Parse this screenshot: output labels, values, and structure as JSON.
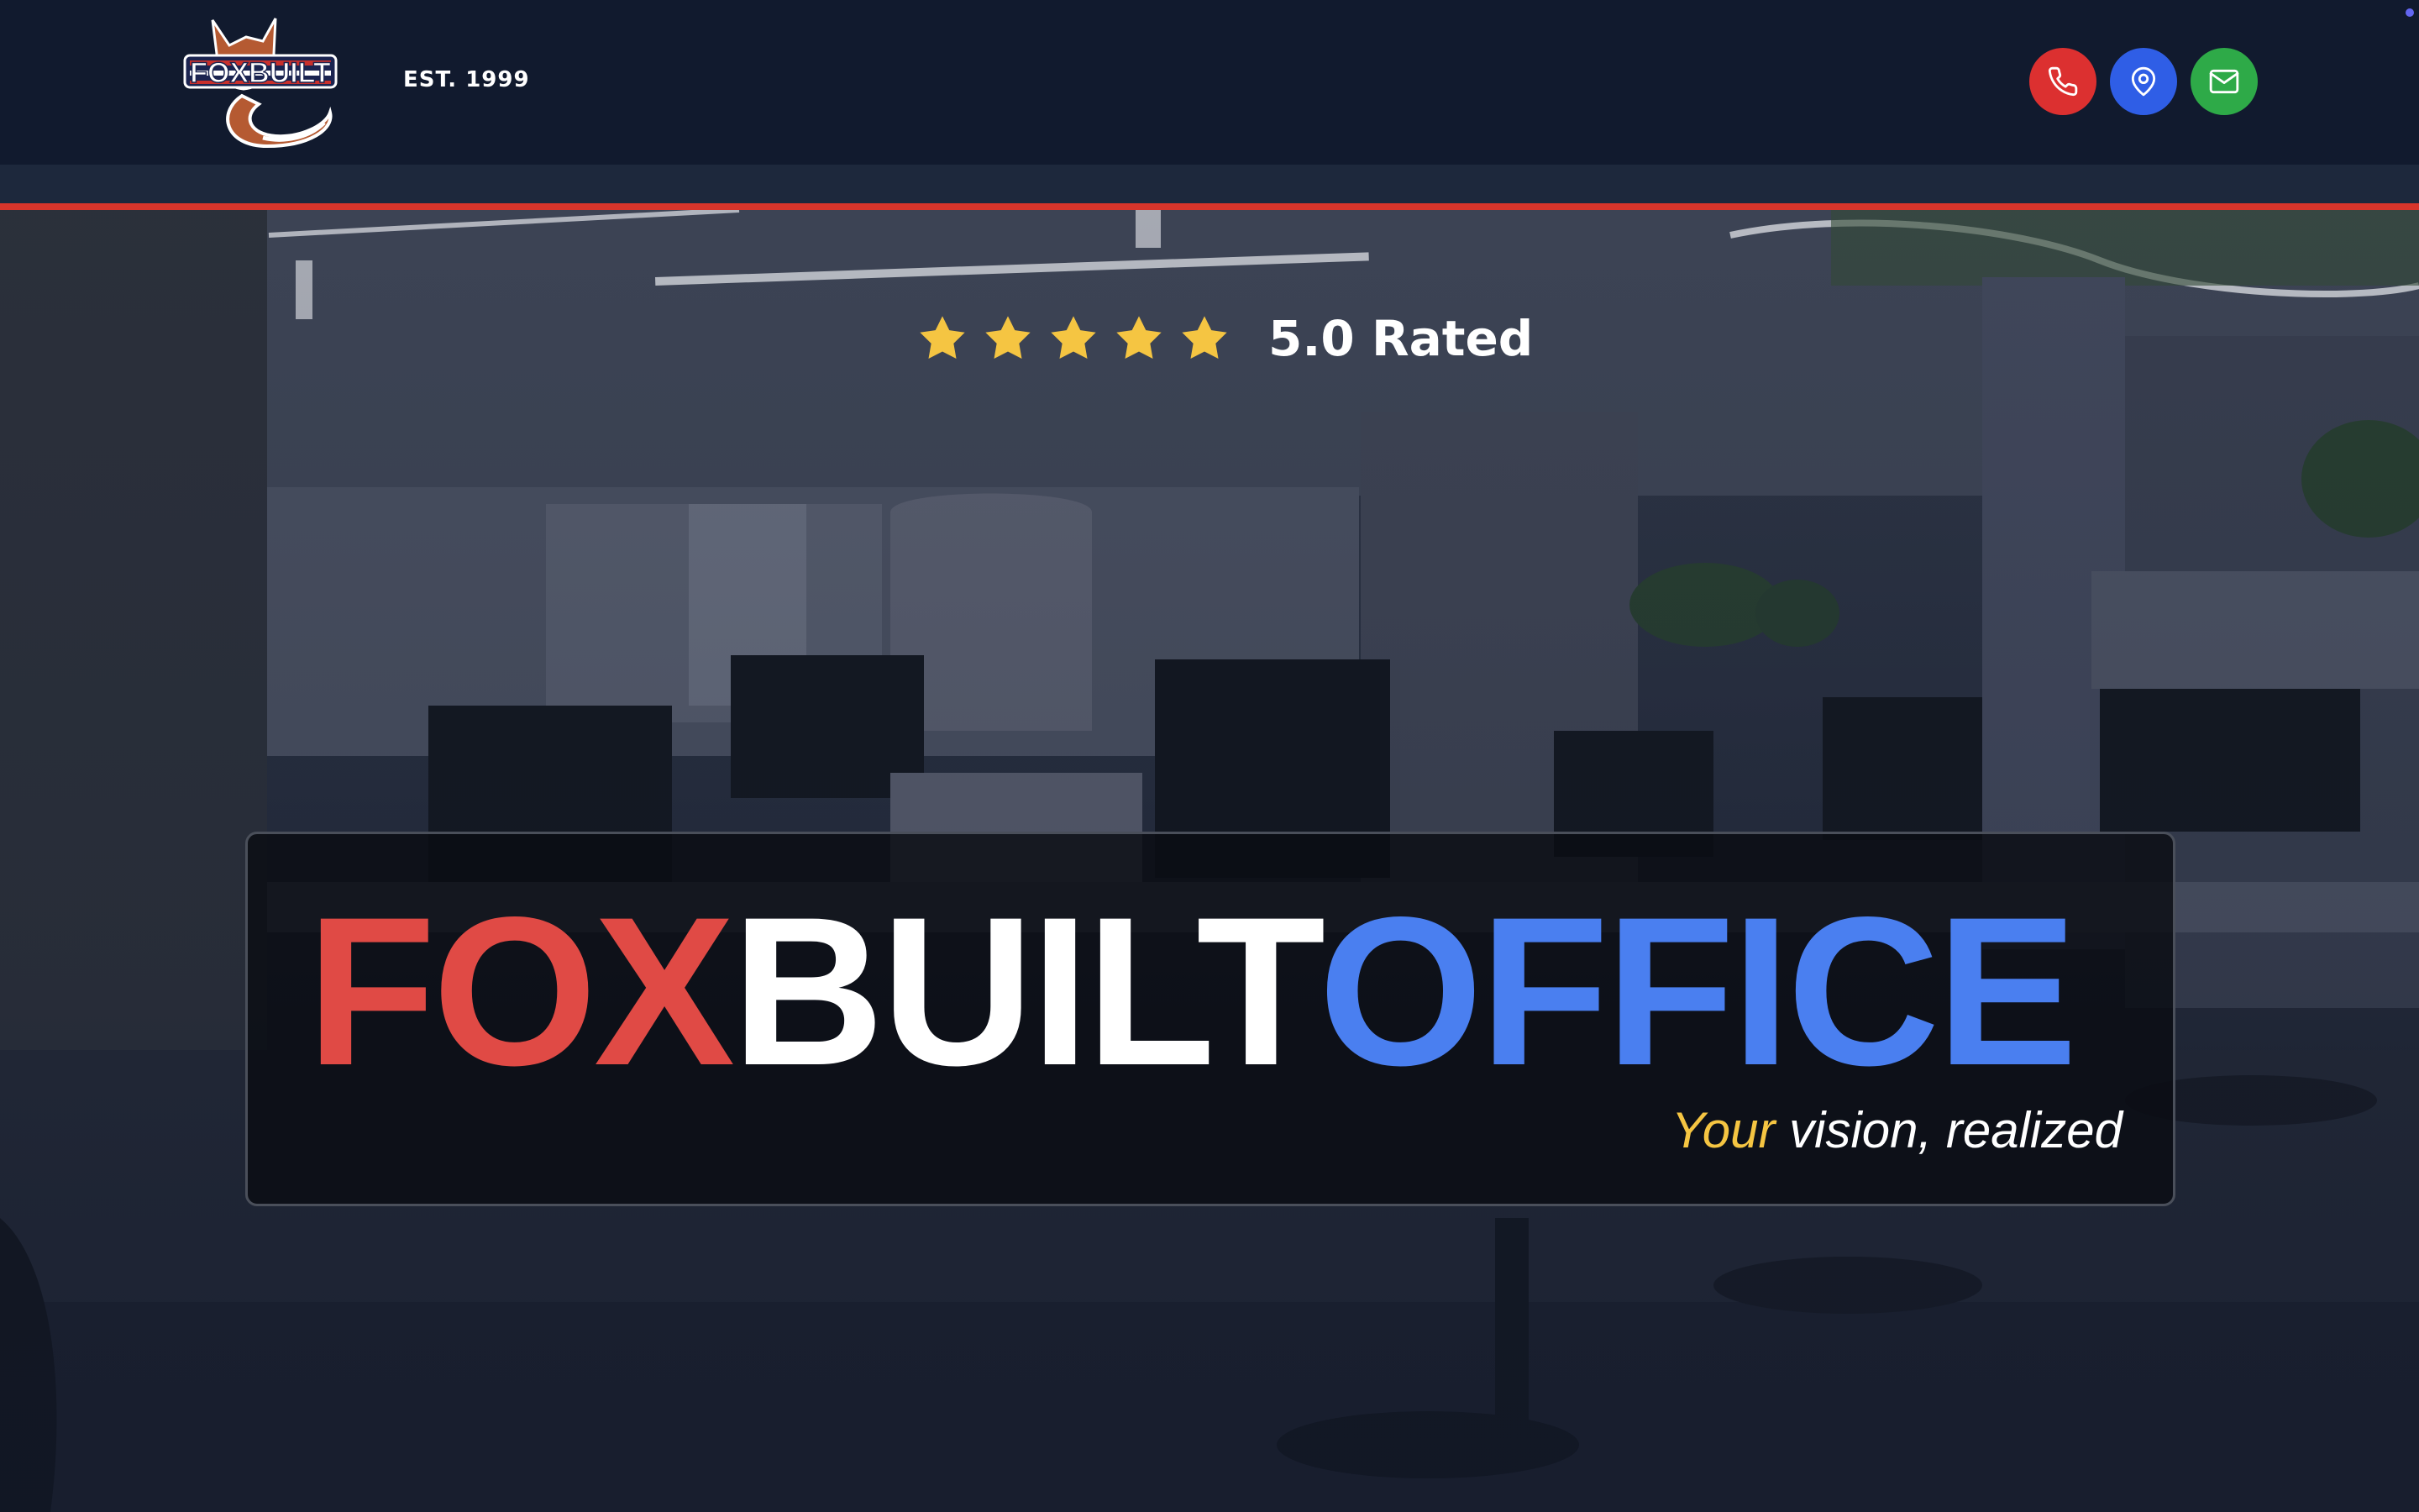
{
  "header": {
    "logo_alt": "FoxBuilt logo",
    "logo_text": "FOXBUILT",
    "established": "EST. 1999",
    "contact": [
      {
        "name": "phone",
        "icon": "phone-icon",
        "color": "#dc3030"
      },
      {
        "name": "location",
        "icon": "map-pin-icon",
        "color": "#2f5ee6"
      },
      {
        "name": "email",
        "icon": "mail-icon",
        "color": "#2eaa48"
      }
    ]
  },
  "hero": {
    "rating": {
      "stars": 5,
      "text": "5.0 Rated",
      "star_color": "#f5c542"
    },
    "brand": {
      "part1": "FOX",
      "part2": "BUILT",
      "part3": "OFFICE",
      "colors": {
        "part1": "#e04a45",
        "part2": "#ffffff",
        "part3": "#4a7ff0"
      }
    },
    "tagline": {
      "accent": "Your",
      "rest": " vision, realized",
      "accent_color": "#f5c542"
    }
  },
  "colors": {
    "header_bg": "#111a2e",
    "accent_line": "#d8352b"
  }
}
